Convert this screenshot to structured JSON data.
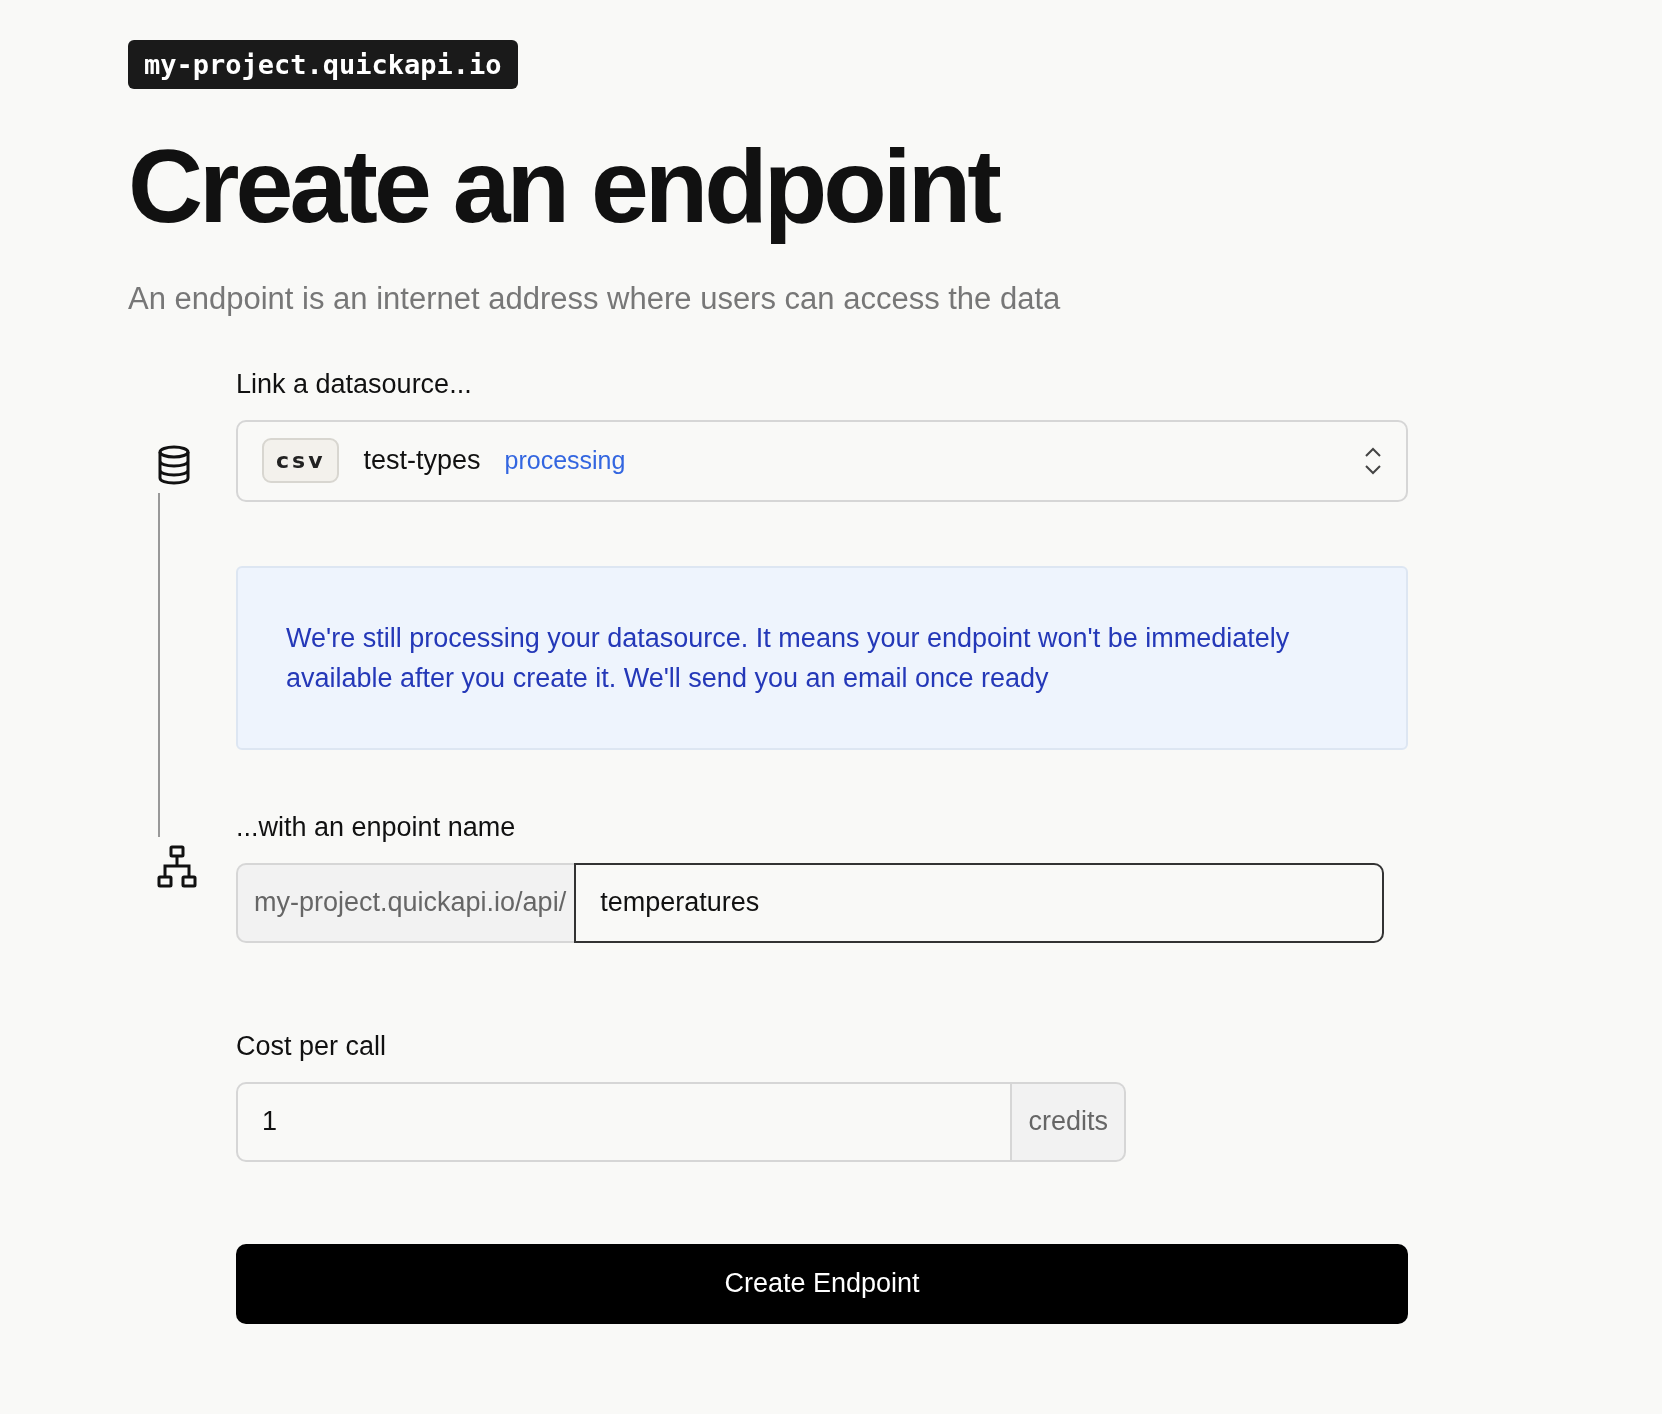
{
  "project_badge": "my-project.quickapi.io",
  "title": "Create an endpoint",
  "subtitle": "An endpoint is an internet address where users can access the data",
  "datasource": {
    "label": "Link a datasource...",
    "type_tag": "csv",
    "name": "test-types",
    "status": "processing"
  },
  "notice": "We're still processing your datasource. It means your endpoint won't be immediately available after you create it. We'll send you an email once ready",
  "endpoint_name": {
    "label": "...with an enpoint name",
    "prefix": "my-project.quickapi.io/api/",
    "value": "temperatures"
  },
  "cost": {
    "label": "Cost per call",
    "value": "1",
    "unit": "credits"
  },
  "submit_button": "Create Endpoint"
}
